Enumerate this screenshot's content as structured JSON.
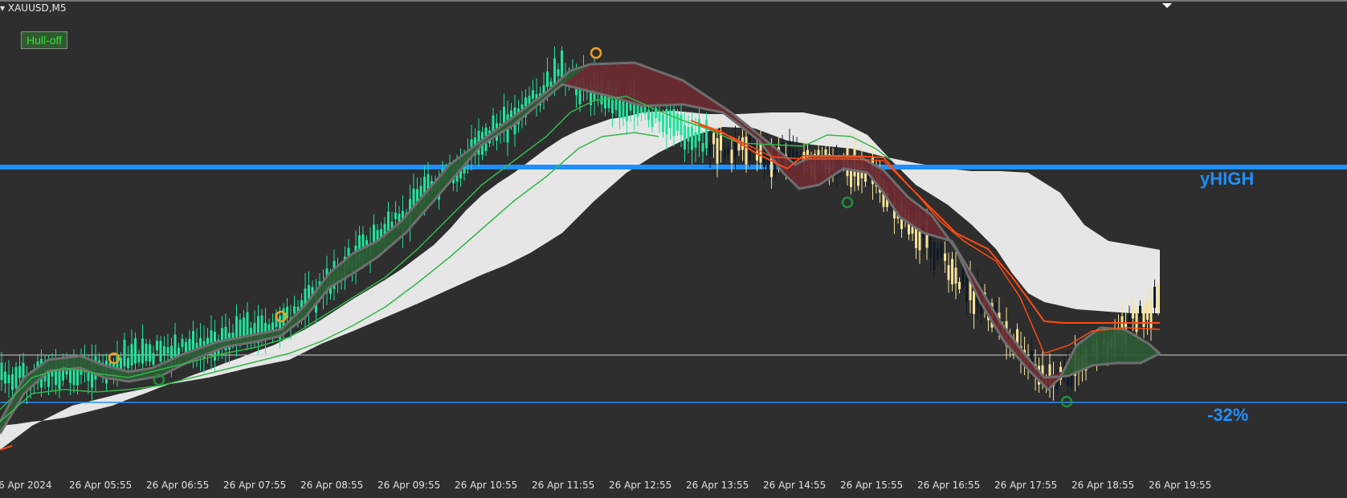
{
  "window": {
    "symbol_label": "XAUUSD,M5"
  },
  "buttons": {
    "hull_label": "Hull-off"
  },
  "levels": {
    "yhigh_label": "yHIGH",
    "pct_label": "-32%"
  },
  "colors": {
    "background": "#2e2e2e",
    "bull_candle": "#1ee39b",
    "bear_candle": "#f5e39a",
    "neutral_candle": "#0f1a26",
    "cloud": "#e6e6e6",
    "level_line": "#1e90ff",
    "hull_up_fill": "#2d5a35",
    "hull_down_fill": "#6a2a30",
    "hull_band": "#6e6e6e",
    "orange_line": "#ff4a10",
    "signal_up": "#f0a020",
    "signal_down": "#1f8f3a"
  },
  "time_axis": {
    "ticks": [
      "6 Apr 2024",
      "26 Apr 05:55",
      "26 Apr 06:55",
      "26 Apr 07:55",
      "26 Apr 08:55",
      "26 Apr 09:55",
      "26 Apr 10:55",
      "26 Apr 11:55",
      "26 Apr 12:55",
      "26 Apr 13:55",
      "26 Apr 14:55",
      "26 Apr 15:55",
      "26 Apr 16:55",
      "26 Apr 17:55",
      "26 Apr 18:55",
      "26 Apr 19:55"
    ]
  }
}
